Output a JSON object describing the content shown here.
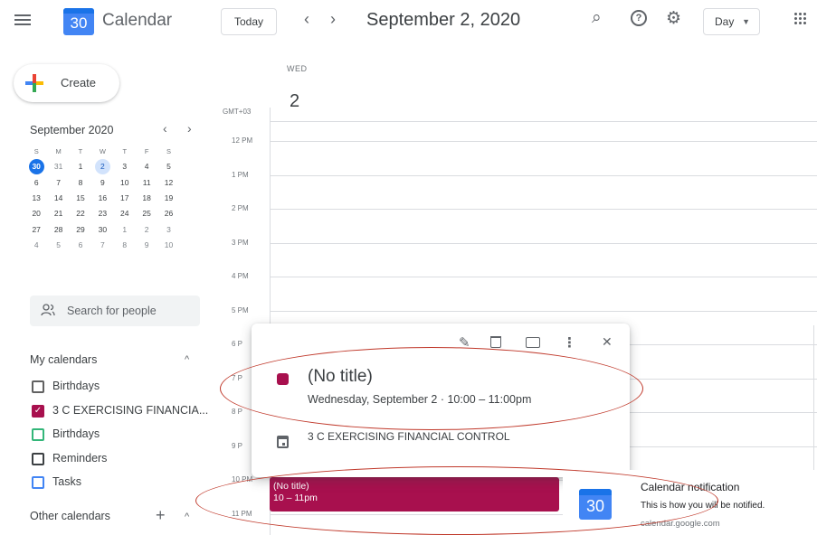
{
  "header": {
    "app_title": "Calendar",
    "logo_day": "30",
    "today_label": "Today",
    "prev_arrow": "‹",
    "next_arrow": "›",
    "date_title": "September 2, 2020",
    "search_icon": "⌕",
    "help_icon": "?",
    "settings_icon": "⚙",
    "view_label": "Day",
    "view_caret": "▼"
  },
  "sidebar": {
    "create_label": "Create",
    "mini_calendar": {
      "title": "September 2020",
      "prev": "‹",
      "next": "›",
      "weekday_headers": [
        "S",
        "M",
        "T",
        "W",
        "T",
        "F",
        "S"
      ],
      "weeks": [
        [
          "30",
          "31",
          "1",
          "2",
          "3",
          "4",
          "5"
        ],
        [
          "6",
          "7",
          "8",
          "9",
          "10",
          "11",
          "12"
        ],
        [
          "13",
          "14",
          "15",
          "16",
          "17",
          "18",
          "19"
        ],
        [
          "20",
          "21",
          "22",
          "23",
          "24",
          "25",
          "26"
        ],
        [
          "27",
          "28",
          "29",
          "30",
          "1",
          "2",
          "3"
        ],
        [
          "4",
          "5",
          "6",
          "7",
          "8",
          "9",
          "10"
        ]
      ],
      "today": "30",
      "selected": "2"
    },
    "search_people_placeholder": "Search for people",
    "my_calendars_title": "My calendars",
    "my_calendars_caret": "^",
    "my_calendars": [
      {
        "label": "Birthdays",
        "color": "#616161",
        "checked": false
      },
      {
        "label": "3 C EXERCISING FINANCIA...",
        "color": "#a8104e",
        "checked": true
      },
      {
        "label": "Birthdays",
        "color": "#33b679",
        "checked": false
      },
      {
        "label": "Reminders",
        "color": "#3c4043",
        "checked": false
      },
      {
        "label": "Tasks",
        "color": "#4285f4",
        "checked": false
      }
    ],
    "other_calendars_title": "Other calendars",
    "other_calendars_add": "+",
    "other_calendars_caret": "^"
  },
  "day_view": {
    "weekday": "WED",
    "day_number": "2",
    "timezone": "GMT+03",
    "hours": [
      "12 PM",
      "1 PM",
      "2 PM",
      "3 PM",
      "4 PM",
      "5 PM",
      "6 P",
      "7 P",
      "8 P",
      "9 P",
      "10 PM",
      "11 PM"
    ]
  },
  "event_block": {
    "title": "(No title)",
    "time": "10 – 11pm",
    "color": "#a8104e"
  },
  "popover": {
    "edit_icon": "✎",
    "delete_icon": "🗑",
    "email_icon": "✉",
    "more_icon": "⋮",
    "close_icon": "✕",
    "title": "(No title)",
    "datetime": "Wednesday, September 2  ·  10:00 – 11:00pm",
    "calendar_name": "3 C EXERCISING FINANCIAL CONTROL"
  },
  "notification": {
    "logo_day": "30",
    "title": "Calendar notification",
    "body": "This is how you will be notified.",
    "source": "calendar.google.com"
  },
  "colors": {
    "accent": "#1a73e8",
    "event": "#a8104e",
    "annotation": "#c0392b"
  }
}
